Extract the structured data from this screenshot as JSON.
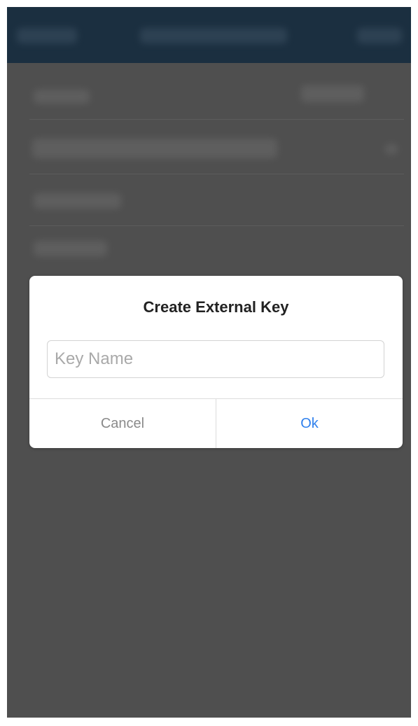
{
  "dialog": {
    "title": "Create External Key",
    "input_placeholder": "Key Name",
    "input_value": "",
    "cancel_label": "Cancel",
    "ok_label": "Ok"
  },
  "colors": {
    "overlay": "#4f4f4f",
    "navbar": "#1b2f40",
    "dialog_bg": "#ffffff",
    "ok_accent": "#2f80ed",
    "cancel_text": "#8a8a8a"
  }
}
